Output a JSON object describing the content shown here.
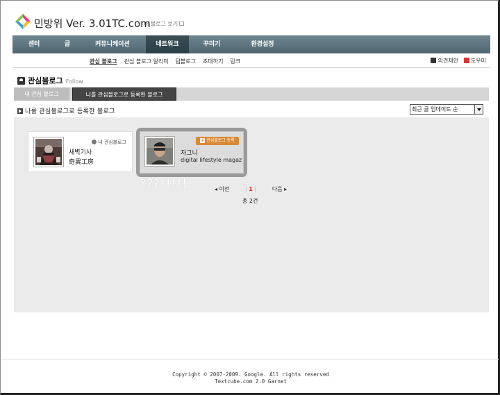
{
  "header": {
    "site_title": "민방위 Ver. 3.01TC.com",
    "view_blog": "내 블로그 보기"
  },
  "mainnav": {
    "items": [
      {
        "label": "센터"
      },
      {
        "label": "글"
      },
      {
        "label": "커뮤니케이션"
      },
      {
        "label": "네트워크",
        "active": true
      },
      {
        "label": "꾸미기"
      },
      {
        "label": "환경설정"
      }
    ]
  },
  "subnav": {
    "items": [
      "관심 블로그",
      "관심 블로그 알리미",
      "팀블로그",
      "초대하기",
      "링크"
    ],
    "active_index": 0,
    "right": [
      "의견제안",
      "도우미"
    ]
  },
  "section": {
    "title": "관심블로그",
    "english": "Follow"
  },
  "tabs": {
    "tab1": "내 관심 블로그",
    "tab2": "나를 관심블로그로 등록한 블로그",
    "active": "tab2"
  },
  "list_header": "나를 관심블로그로 등록한 블로그",
  "sort": {
    "selected": "최근 글 업데이트 순"
  },
  "cards": [
    {
      "name": "새벽기사",
      "subtitle": "奇異工房",
      "tag": "내 관심블로그"
    },
    {
      "name": "자그니",
      "subtitle": "digital lifestyle magazine",
      "button": "관심블로그 등록"
    }
  ],
  "annotation": "???!!!!!!",
  "pager": {
    "prev": "이전",
    "current": "1",
    "next": "다음",
    "total": "총 2건"
  },
  "footer": {
    "line1": "Copyright © 2007-2009. Google. All rights reserved",
    "line2": "Textcube.com 2.0 Garnet"
  },
  "colors": {
    "nav_bg": "#5f7680",
    "nav_active": "#33474f",
    "accent_button": "#d88a35",
    "pager_current": "#e02020"
  }
}
